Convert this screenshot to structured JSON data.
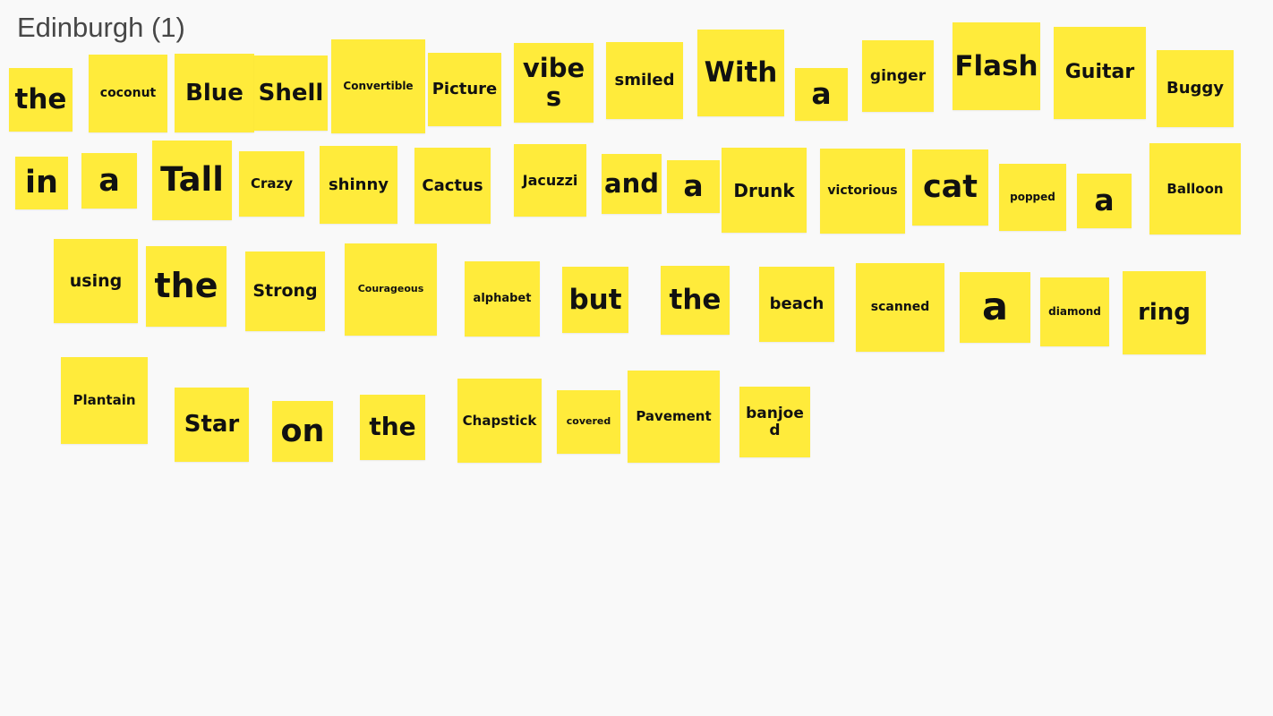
{
  "board": {
    "title": "Edinburgh (1)",
    "note_color": "#ffeb3b"
  },
  "notes": [
    {
      "id": "the-1",
      "text": "the"
    },
    {
      "id": "coconut",
      "text": "coconut"
    },
    {
      "id": "blue",
      "text": "Blue"
    },
    {
      "id": "shell",
      "text": "Shell"
    },
    {
      "id": "convertible",
      "text": "Convertible"
    },
    {
      "id": "picture",
      "text": "Picture"
    },
    {
      "id": "vibes",
      "text": "vibes"
    },
    {
      "id": "smiled",
      "text": "smiled"
    },
    {
      "id": "with",
      "text": "With"
    },
    {
      "id": "a-1",
      "text": "a"
    },
    {
      "id": "ginger",
      "text": "ginger"
    },
    {
      "id": "flash",
      "text": "Flash"
    },
    {
      "id": "guitar",
      "text": "Guitar"
    },
    {
      "id": "buggy",
      "text": "Buggy"
    },
    {
      "id": "in",
      "text": "in"
    },
    {
      "id": "a-2",
      "text": "a"
    },
    {
      "id": "tall",
      "text": "Tall"
    },
    {
      "id": "crazy",
      "text": "Crazy"
    },
    {
      "id": "shinny",
      "text": "shinny"
    },
    {
      "id": "cactus",
      "text": "Cactus"
    },
    {
      "id": "jacuzzi",
      "text": "Jacuzzi"
    },
    {
      "id": "and",
      "text": "and"
    },
    {
      "id": "a-3",
      "text": "a"
    },
    {
      "id": "drunk",
      "text": "Drunk"
    },
    {
      "id": "victorious",
      "text": "victorious"
    },
    {
      "id": "cat",
      "text": "cat"
    },
    {
      "id": "popped",
      "text": "popped"
    },
    {
      "id": "a-4",
      "text": "a"
    },
    {
      "id": "balloon",
      "text": "Balloon"
    },
    {
      "id": "using",
      "text": "using"
    },
    {
      "id": "the-2",
      "text": "the"
    },
    {
      "id": "strong",
      "text": "Strong"
    },
    {
      "id": "courageous",
      "text": "Courageous"
    },
    {
      "id": "alphabet",
      "text": "alphabet"
    },
    {
      "id": "but",
      "text": "but"
    },
    {
      "id": "the-3",
      "text": "the"
    },
    {
      "id": "beach",
      "text": "beach"
    },
    {
      "id": "scanned",
      "text": "scanned"
    },
    {
      "id": "a-5",
      "text": "a"
    },
    {
      "id": "diamond",
      "text": "diamond"
    },
    {
      "id": "ring",
      "text": "ring"
    },
    {
      "id": "plantain",
      "text": "Plantain"
    },
    {
      "id": "star",
      "text": "Star"
    },
    {
      "id": "on",
      "text": "on"
    },
    {
      "id": "the-4",
      "text": "the"
    },
    {
      "id": "chapstick",
      "text": "Chapstick"
    },
    {
      "id": "covered",
      "text": "covered"
    },
    {
      "id": "pavement",
      "text": "Pavement"
    },
    {
      "id": "banjoed",
      "text": "banjoed"
    }
  ]
}
